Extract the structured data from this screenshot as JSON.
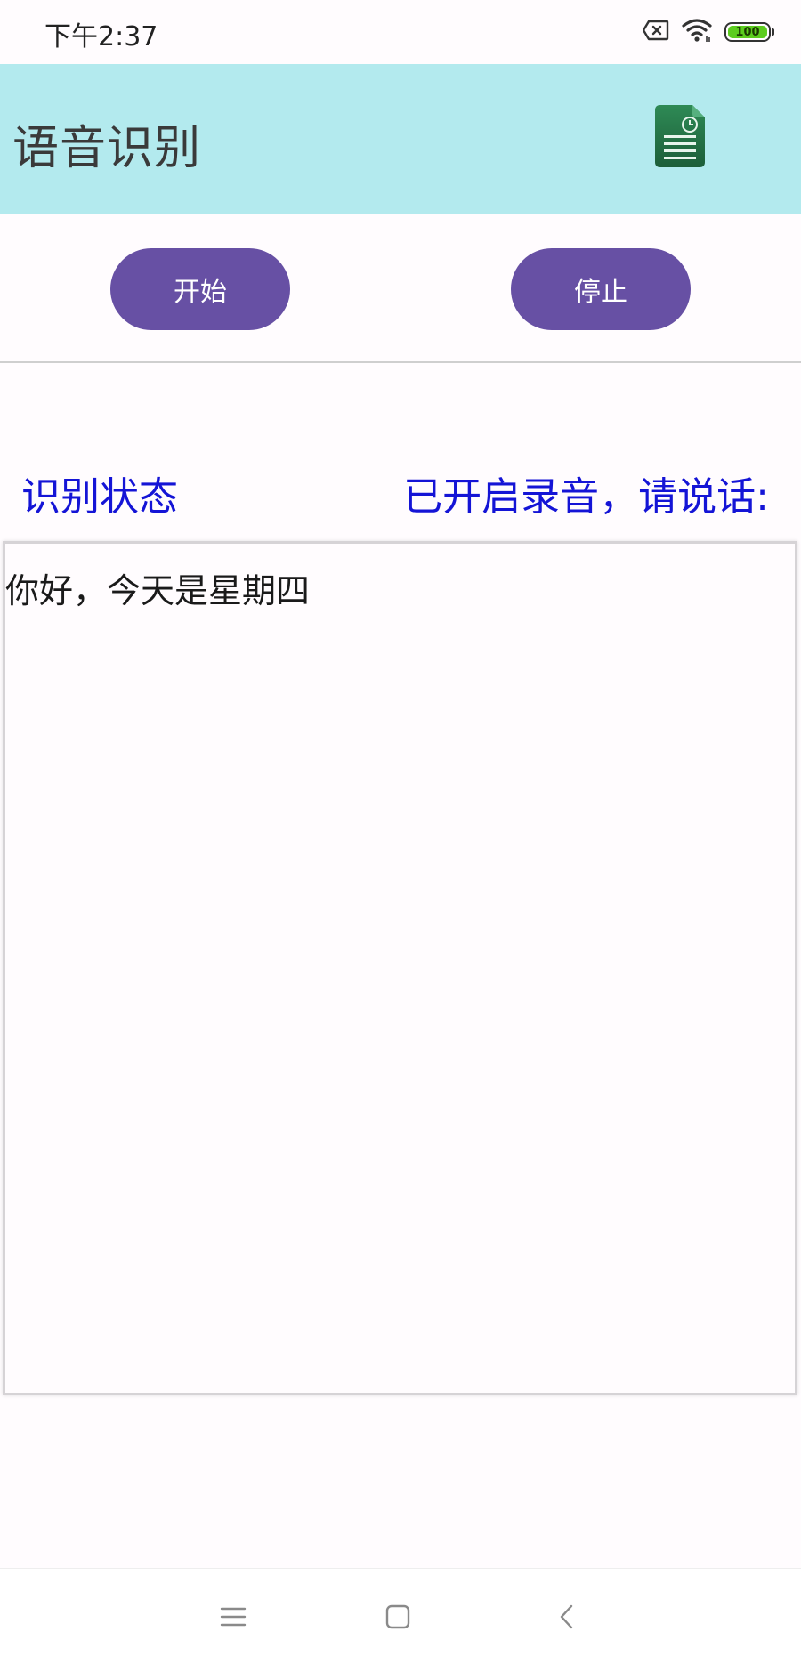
{
  "status_bar": {
    "time": "下午2:37",
    "battery_level": "100",
    "icons": [
      "sim-disabled-icon",
      "wifi-icon",
      "battery-icon"
    ]
  },
  "app_bar": {
    "title": "语音识别",
    "action_icon": "document-clock-icon"
  },
  "controls": {
    "start_label": "开始",
    "stop_label": "停止"
  },
  "recognition": {
    "status_label": "识别状态",
    "status_value": "已开启录音，请说话:",
    "result_text": "你好，今天是星期四"
  },
  "navigation": {
    "icons": [
      "menu-icon",
      "home-icon",
      "back-icon"
    ]
  },
  "colors": {
    "app_bar_bg": "#b3eaee",
    "button_bg": "#6750a4",
    "status_text": "#1414d6",
    "battery_fill": "#5ccc1e"
  }
}
